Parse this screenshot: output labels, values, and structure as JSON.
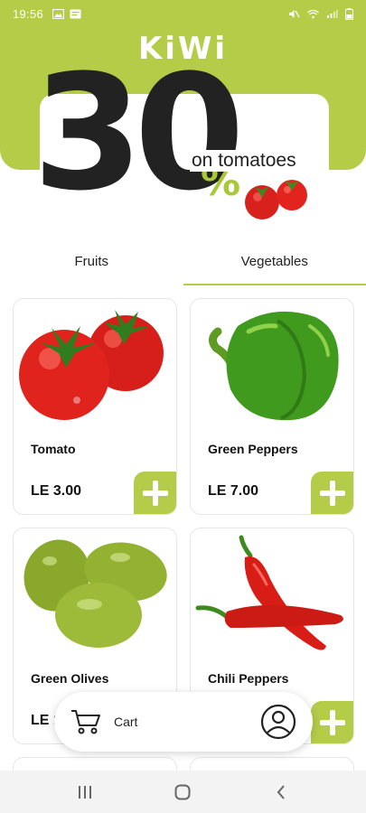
{
  "status_bar": {
    "time": "19:56",
    "icons_left": [
      "image-icon",
      "message-icon"
    ],
    "icons_right": [
      "mute-icon",
      "wifi-icon",
      "signal-icon",
      "battery-icon"
    ]
  },
  "app": {
    "logo": "KiWi",
    "brand_color": "#b5cc48"
  },
  "promo": {
    "number": "30",
    "percent_sign": "%",
    "text": "on tomatoes"
  },
  "tabs": [
    {
      "label": "Fruits",
      "active": false
    },
    {
      "label": "Vegetables",
      "active": true
    }
  ],
  "products": [
    {
      "name": "Tomato",
      "price": "LE 3.00",
      "image": "tomato"
    },
    {
      "name": "Green Peppers",
      "price": "LE 7.00",
      "image": "green-pepper"
    },
    {
      "name": "Green Olives",
      "price": "LE 1",
      "image": "green-olives"
    },
    {
      "name": "Chili Peppers",
      "price": "",
      "image": "chili-peppers"
    }
  ],
  "cart": {
    "label": "Cart"
  },
  "nav": {
    "buttons": [
      "recent-apps-icon",
      "home-icon",
      "back-icon"
    ]
  }
}
